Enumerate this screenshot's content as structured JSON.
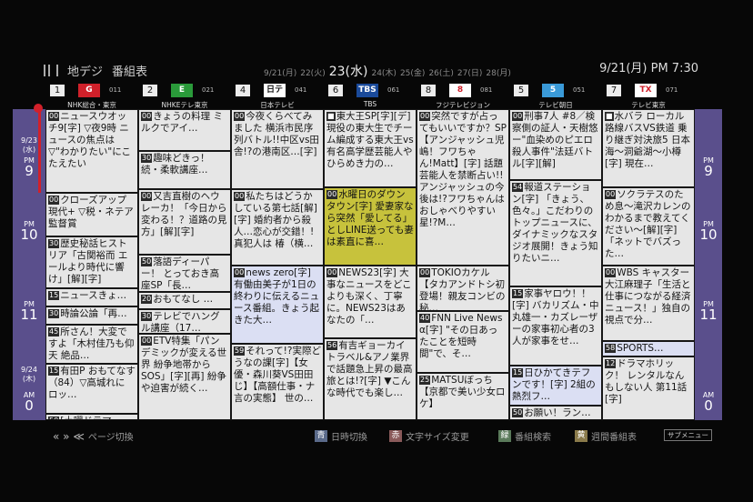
{
  "header": {
    "app_name": "地デジ",
    "screen_title": "番組表",
    "current_date_time": "9/21(月) PM 7:30",
    "dates": [
      "9/21(月)",
      "22(火)",
      "23(水)",
      "24(木)",
      "25(金)",
      "26(土)",
      "27(日)",
      "28(月)"
    ],
    "selected_date_index": 2
  },
  "channels": [
    {
      "number": "1",
      "logo": "G",
      "logo_color": "#d0202a",
      "logo_text_color": "#ffffff",
      "id": "011",
      "name": "NHK総合・東京"
    },
    {
      "number": "2",
      "logo": "E",
      "logo_color": "#2a9a3a",
      "logo_text_color": "#ffffff",
      "id": "021",
      "name": "NHKEテレ東京"
    },
    {
      "number": "4",
      "logo": "日テレ",
      "logo_color": "#ffffff",
      "logo_text_color": "#111111",
      "id": "041",
      "name": "日本テレビ"
    },
    {
      "number": "6",
      "logo": "TBS",
      "logo_color": "#1a4a9a",
      "logo_text_color": "#ffffff",
      "id": "061",
      "name": "TBS"
    },
    {
      "number": "8",
      "logo": "8",
      "logo_color": "#ffffff",
      "logo_text_color": "#d0202a",
      "id": "081",
      "name": "フジテレビジョン"
    },
    {
      "number": "5",
      "logo": "5",
      "logo_color": "#3a9ad8",
      "logo_text_color": "#ffffff",
      "id": "051",
      "name": "テレビ朝日"
    },
    {
      "number": "7",
      "logo": "TX",
      "logo_color": "#ffffff",
      "logo_text_color": "#d0202a",
      "id": "071",
      "name": "テレビ東京"
    }
  ],
  "time_axis": {
    "date_top": "9/23",
    "weekday_top": "(水)",
    "date_bottom": "9/24",
    "weekday_bottom": "(木)",
    "slots": [
      {
        "ampm": "PM",
        "hour": "9"
      },
      {
        "ampm": "PM",
        "hour": "10"
      },
      {
        "ampm": "PM",
        "hour": "11"
      },
      {
        "ampm": "AM",
        "hour": "0"
      }
    ]
  },
  "programs": [
    [
      {
        "min": "00",
        "title": "ニュースウオッチ9[字] ▽夜9時 ニュースの焦点は ▽\"わかりたい\"にこたえたい"
      },
      {
        "min": "00",
        "title": "クローズアップ現代+ ▽税・ネテア監督賞"
      },
      {
        "min": "30",
        "title": "歴史秘話ヒストリア「古関裕而 エールより時代に響け」[解][字]"
      },
      {
        "min": "15",
        "title": "ニュースきょ…"
      },
      {
        "min": "30",
        "title": "時論公論「再…"
      },
      {
        "min": "45",
        "title": "所さん！大変ですよ「木村佳乃も仰天 絶品…"
      },
      {
        "min": "15",
        "title": "有田P おもてなす（84）▽高城れに ロッ…"
      },
      {
        "min": "50",
        "title": "[土曜ドラマ…"
      }
    ],
    [
      {
        "min": "00",
        "title": "きょうの料理 ミルクでアイ…"
      },
      {
        "min": "30",
        "title": "趣味どきっ！続・柔軟講座…"
      },
      {
        "min": "00",
        "title": "又吉直樹のヘウレーカ！「今日から変わる！？道路の見方」[解][字]"
      },
      {
        "min": "50",
        "title": "落語ディーパー！ とっておき高座SP「長…"
      },
      {
        "min": "20",
        "title": "おもてなし …"
      },
      {
        "min": "30",
        "title": "テレビでハングル講座（17…"
      },
      {
        "min": "00",
        "title": "ETV特集「パンデミックが変える世界 紛争地帯からSOS」[字][再] 紛争や迫害が続く…"
      }
    ],
    [
      {
        "min": "00",
        "title": "今夜くらべてみました 横浜市民序列バトル!!中区vs田舎!?の港南区…[字]"
      },
      {
        "min": "00",
        "title": "私たちはどうかしている第七話[解][字] 婚約者から殺人…恋心が交錯！!真犯人は 椿（横…"
      },
      {
        "min": "00",
        "title": "news zero[字] 有働由美子が1日の終わりに伝えるニュース番組。きょう起きた大…"
      },
      {
        "min": "59",
        "title": "それって!?実際どうなの課[字]【女優・森川葵VS田田じ】【高額仕事・ナ言の実態】 世の…"
      }
    ],
    [
      {
        "min": "",
        "title": "東大王SP[字][デ] 現役の東大生でチーム編成する東大王vs有名高学歴芸能人やひらめき力の…"
      },
      {
        "min": "00",
        "title": "水曜日のダウンタウン[字] 愛妻家なら突然「愛してる」としLINE送っても妻は素直に喜…"
      },
      {
        "min": "00",
        "title": "NEWS23[字] 大事なニュースをどこよりも深く、丁寧に。NEWS23はあなたの「…"
      },
      {
        "min": "56",
        "title": "有吉ギョーカイトラベル&アノ業界で話題急上昇の最高旅とは!?[字] ▼こんな時代でも楽し…"
      }
    ],
    [
      {
        "min": "00",
        "title": "突然ですが占ってもいいですか？SP【アンジャッシュ児嶋！フワちゃん!Matt】[字] 話題芸能人を禁断占い!!アンジャッシュの今後は!?フワちゃんはおしゃべりやすい星!?M…"
      },
      {
        "min": "00",
        "title": "TOKIOカケル【タカアンドトシ初登場！親友コンビの秘…"
      },
      {
        "min": "40",
        "title": "FNN Live News α[字] \"その日あったことを短時間\"で、そ…"
      },
      {
        "min": "25",
        "title": "MATSUぼっち【京都で美い少女ロケ】"
      }
    ],
    [
      {
        "min": "00",
        "title": "刑事7人 #8／検察側の証人・天樹悠ー\"血染めのピエロ殺人事件\"法廷バトル[字][解]"
      },
      {
        "min": "54",
        "title": "報道ステーション[字] 「きょう、色々。」こだわりのトップニュースに、ダイナミックなスタジオ展開！きょう知りたいニ…"
      },
      {
        "min": "15",
        "title": "家事ヤロウ！！[字] バカリズム・中丸雄一・カズレーザーの家事初心者の3人が家事をせ…"
      },
      {
        "min": "15",
        "title": "日ひかてきテフンです！[字] 2組の熱烈フ…"
      },
      {
        "min": "50",
        "title": "お願い！ラン…"
      }
    ],
    [
      {
        "min": "",
        "title": "水バラ ローカル路線バスVS鉄道 乗り継ぎ対決旅5 日本海〜洞爺湖〜小樽[字] 現在…"
      },
      {
        "min": "00",
        "title": "ソクラテスのため息〜滝沢カレンのわかるまで教えてください〜[解][字] 「ネットでバズった…"
      },
      {
        "min": "00",
        "title": "WBS キャスター大江麻理子「生活と仕事につながる経済ニュース！」独自の視点で分…"
      },
      {
        "min": "58",
        "title": "SPORTS…"
      },
      {
        "min": "12",
        "title": "ドラマホリック！ レンタルなんもしない人 第11話[字]"
      }
    ]
  ],
  "footer": {
    "page_switch": "ページ切換",
    "blue_key": "青",
    "blue_label": "日時切換",
    "red_key": "赤",
    "red_label": "文字サイズ変更",
    "green_key": "緑",
    "green_label": "番組検索",
    "yellow_key": "黄",
    "yellow_label": "週間番組表",
    "submenu": "サブメニュー"
  }
}
